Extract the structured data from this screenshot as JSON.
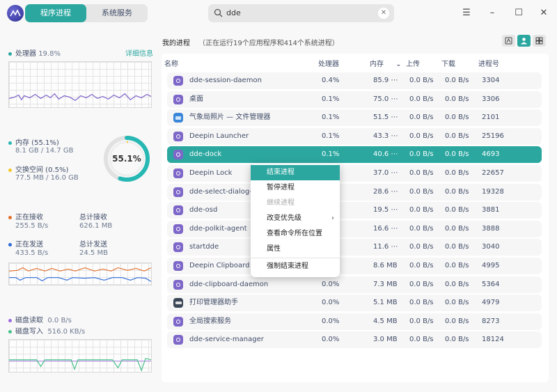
{
  "titlebar": {
    "tabs": [
      "程序进程",
      "系统服务"
    ],
    "search_value": "dde",
    "buttons": [
      "menu-icon",
      "minimize-icon",
      "maximize-icon",
      "close-icon"
    ]
  },
  "cpu": {
    "label": "处理器",
    "value": "19.8%",
    "detail_link": "详细信息"
  },
  "memory": {
    "label": "内存 (55.1%)",
    "usage": "8.1 GB / 14.7 GB",
    "swap_label": "交换空间 (0.5%)",
    "swap_usage": "77.5 MB / 16.0 GB",
    "ring_text": "55.1%",
    "mem_fraction": 0.551,
    "swap_fraction": 0.005
  },
  "network": {
    "recv_label": "正在接收",
    "recv_value": "255.5 B/s",
    "total_recv_label": "总计接收",
    "total_recv_value": "626.1 MB",
    "send_label": "正在发送",
    "send_value": "433.5 B/s",
    "total_send_label": "总计发送",
    "total_send_value": "24.5 MB"
  },
  "disk": {
    "read_label": "磁盘读取",
    "read_value": "0.0 B/s",
    "write_label": "磁盘写入",
    "write_value": "516.0 KB/s"
  },
  "colors": {
    "accent": "#2ca7a0",
    "cpu_line": "#7b5ec8",
    "recv": "#e0702c",
    "send": "#2d6bd8",
    "read": "#9d6be0",
    "write": "#46c08b",
    "swap": "#f3c72b"
  },
  "processes": {
    "title": "我的进程",
    "subtitle": "（正在运行19个应用程序和414个系统进程）",
    "columns": {
      "name": "名称",
      "cpu": "处理器",
      "mem": "内存",
      "up": "上传",
      "down": "下载",
      "pid": "进程号"
    },
    "rows": [
      {
        "icon": "dde",
        "name": "dde-session-daemon",
        "cpu": "0.4%",
        "mem": "85.9 ⋯",
        "up": "0.0 B/s",
        "down": "0.0 B/s",
        "pid": "3304"
      },
      {
        "icon": "dde",
        "name": "桌面",
        "cpu": "0.1%",
        "mem": "75.0 ⋯",
        "up": "0.0 B/s",
        "down": "0.0 B/s",
        "pid": "3306"
      },
      {
        "icon": "folder",
        "name": "气象局照片 — 文件管理器",
        "cpu": "0.1%",
        "mem": "51.5 ⋯",
        "up": "0.0 B/s",
        "down": "0.0 B/s",
        "pid": "2101"
      },
      {
        "icon": "dde",
        "name": "Deepin Launcher",
        "cpu": "0.1%",
        "mem": "43.3 ⋯",
        "up": "0.0 B/s",
        "down": "0.0 B/s",
        "pid": "25196"
      },
      {
        "icon": "dde",
        "name": "dde-dock",
        "cpu": "0.1%",
        "mem": "40.6 ⋯",
        "up": "0.0 B/s",
        "down": "0.0 B/s",
        "pid": "4693",
        "selected": true
      },
      {
        "icon": "dde",
        "name": "Deepin Lock",
        "cpu": "",
        "mem": "37.0 ⋯",
        "up": "0.0 B/s",
        "down": "0.0 B/s",
        "pid": "22657"
      },
      {
        "icon": "dde",
        "name": "dde-select-dialog-",
        "cpu": "",
        "mem": "28.6 ⋯",
        "up": "0.0 B/s",
        "down": "0.0 B/s",
        "pid": "19328"
      },
      {
        "icon": "dde",
        "name": "dde-osd",
        "cpu": "",
        "mem": "19.5 ⋯",
        "up": "0.0 B/s",
        "down": "0.0 B/s",
        "pid": "3881"
      },
      {
        "icon": "dde",
        "name": "dde-polkit-agent",
        "cpu": "",
        "mem": "16.6 ⋯",
        "up": "0.0 B/s",
        "down": "0.0 B/s",
        "pid": "3888"
      },
      {
        "icon": "dde",
        "name": "startdde",
        "cpu": "",
        "mem": "11.6 ⋯",
        "up": "0.0 B/s",
        "down": "0.0 B/s",
        "pid": "3040"
      },
      {
        "icon": "dde",
        "name": "Deepin Clipboard",
        "cpu": "",
        "mem": "8.6 MB",
        "up": "0.0 B/s",
        "down": "0.0 B/s",
        "pid": "4995"
      },
      {
        "icon": "dde",
        "name": "dde-clipboard-daemon",
        "cpu": "0.0%",
        "mem": "7.3 MB",
        "up": "0.0 B/s",
        "down": "0.0 B/s",
        "pid": "5364"
      },
      {
        "icon": "printer",
        "name": "打印管理器助手",
        "cpu": "0.0%",
        "mem": "5.1 MB",
        "up": "0.0 B/s",
        "down": "0.0 B/s",
        "pid": "4979"
      },
      {
        "icon": "dde",
        "name": "全局搜索服务",
        "cpu": "0.0%",
        "mem": "4.5 MB",
        "up": "0.0 B/s",
        "down": "0.0 B/s",
        "pid": "8273"
      },
      {
        "icon": "dde",
        "name": "dde-service-manager",
        "cpu": "0.0%",
        "mem": "3.0 MB",
        "up": "0.0 B/s",
        "down": "0.0 B/s",
        "pid": "18124"
      }
    ]
  },
  "context_menu": {
    "items": [
      {
        "label": "结束进程",
        "state": "highlighted"
      },
      {
        "label": "暂停进程",
        "state": "normal"
      },
      {
        "label": "继续进程",
        "state": "disabled"
      },
      {
        "label": "改变优先级",
        "state": "submenu"
      },
      {
        "label": "查看命令所在位置",
        "state": "normal"
      },
      {
        "label": "属性",
        "state": "normal"
      },
      {
        "label": "强制结束进程",
        "state": "normal",
        "separator_before": true
      }
    ]
  }
}
